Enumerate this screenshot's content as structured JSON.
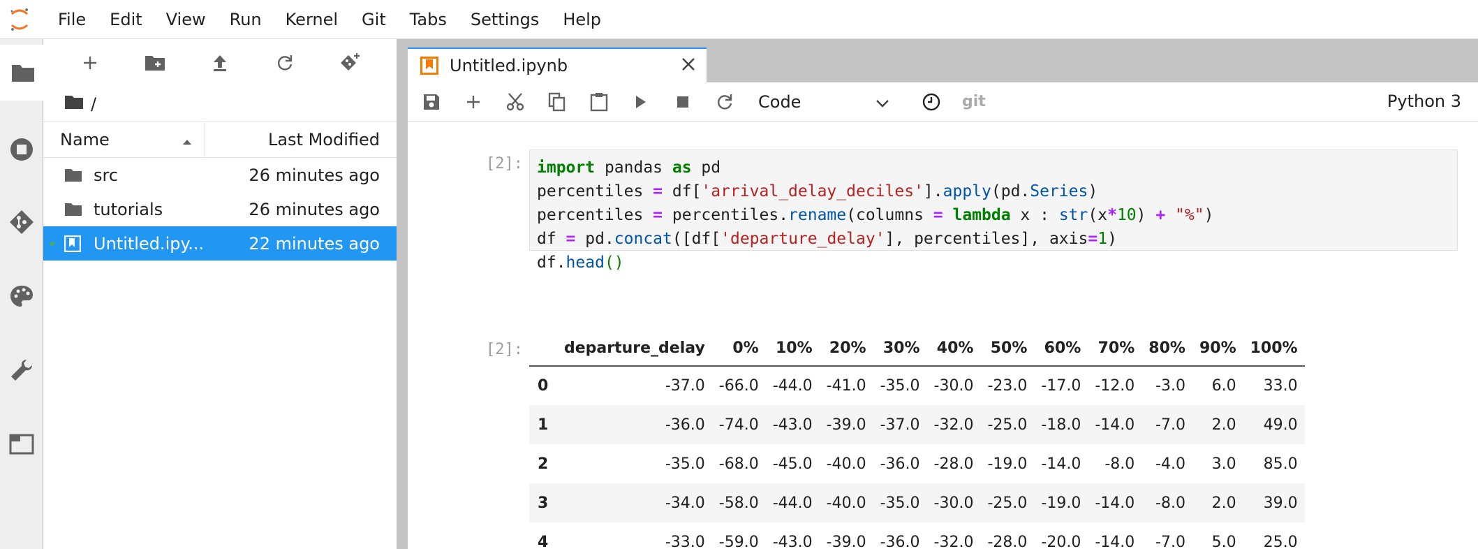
{
  "menubar": {
    "items": [
      "File",
      "Edit",
      "View",
      "Run",
      "Kernel",
      "Git",
      "Tabs",
      "Settings",
      "Help"
    ],
    "logo_icon": "jupyter-logo-icon"
  },
  "activity_bar": {
    "items": [
      {
        "name": "folder-icon",
        "active": true
      },
      {
        "name": "running-icon",
        "active": false
      },
      {
        "name": "git-icon",
        "active": false
      },
      {
        "name": "palette-icon",
        "active": false
      },
      {
        "name": "wrench-icon",
        "active": false
      },
      {
        "name": "tabs-icon",
        "active": false
      }
    ]
  },
  "filebrowser": {
    "toolbar": [
      "plus-icon",
      "new-folder-icon",
      "upload-icon",
      "refresh-icon",
      "git-clone-icon"
    ],
    "breadcrumb": "/",
    "header": {
      "name": "Name",
      "modified": "Last Modified"
    },
    "files": [
      {
        "name": "src",
        "modified": "26 minutes ago",
        "type": "folder",
        "selected": false
      },
      {
        "name": "tutorials",
        "modified": "26 minutes ago",
        "type": "folder",
        "selected": false
      },
      {
        "name": "Untitled.ipy...",
        "modified": "22 minutes ago",
        "type": "notebook",
        "selected": true
      }
    ]
  },
  "tab": {
    "label": "Untitled.ipynb"
  },
  "notebook_toolbar": {
    "cell_type": "Code",
    "git_label": "git",
    "kernel": "Python 3"
  },
  "cells": {
    "input_prompt": "[2]:",
    "output_prompt": "[2]:"
  },
  "output_table": {
    "columns": [
      "departure_delay",
      "0%",
      "10%",
      "20%",
      "30%",
      "40%",
      "50%",
      "60%",
      "70%",
      "80%",
      "90%",
      "100%"
    ],
    "rows": [
      {
        "index": "0",
        "values": [
          "-37.0",
          "-66.0",
          "-44.0",
          "-41.0",
          "-35.0",
          "-30.0",
          "-23.0",
          "-17.0",
          "-12.0",
          "-3.0",
          "6.0",
          "33.0"
        ]
      },
      {
        "index": "1",
        "values": [
          "-36.0",
          "-74.0",
          "-43.0",
          "-39.0",
          "-37.0",
          "-32.0",
          "-25.0",
          "-18.0",
          "-14.0",
          "-7.0",
          "2.0",
          "49.0"
        ]
      },
      {
        "index": "2",
        "values": [
          "-35.0",
          "-68.0",
          "-45.0",
          "-40.0",
          "-36.0",
          "-28.0",
          "-19.0",
          "-14.0",
          "-8.0",
          "-4.0",
          "3.0",
          "85.0"
        ]
      },
      {
        "index": "3",
        "values": [
          "-34.0",
          "-58.0",
          "-44.0",
          "-40.0",
          "-35.0",
          "-30.0",
          "-25.0",
          "-19.0",
          "-14.0",
          "-8.0",
          "2.0",
          "39.0"
        ]
      },
      {
        "index": "4",
        "values": [
          "-33.0",
          "-59.0",
          "-43.0",
          "-39.0",
          "-36.0",
          "-32.0",
          "-28.0",
          "-20.0",
          "-14.0",
          "-7.0",
          "5.0",
          "25.0"
        ]
      }
    ]
  },
  "colors": {
    "accent": "#2196f3",
    "notebook_icon": "#f57c00",
    "keyword": "#008000",
    "string": "#ba2121"
  }
}
